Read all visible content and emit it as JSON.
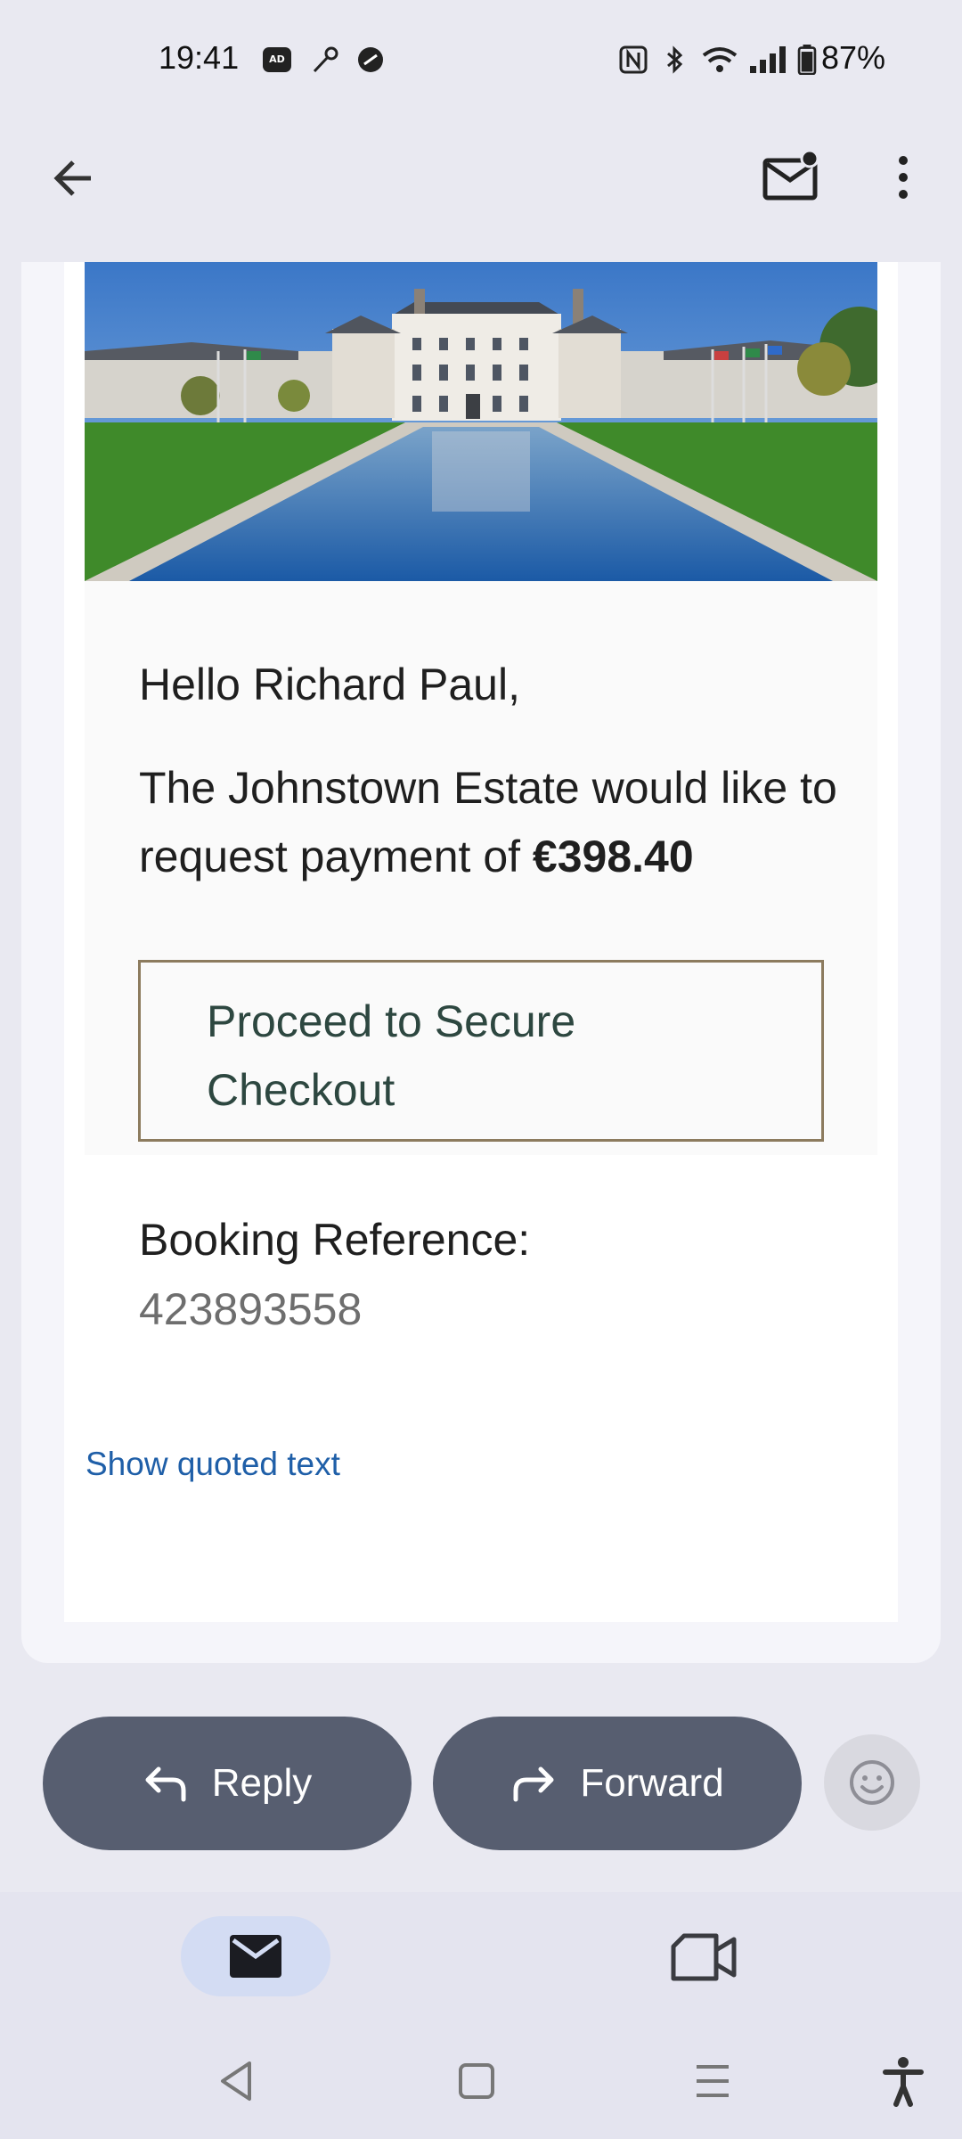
{
  "status_bar": {
    "time": "19:41",
    "battery": "87%",
    "left_icons": [
      "ad-blocker-icon",
      "key-icon",
      "vpn-icon"
    ],
    "right_icons": [
      "nfc-icon",
      "bluetooth-icon",
      "wifi-icon",
      "signal-icon",
      "battery-icon"
    ]
  },
  "app_bar": {
    "icons": [
      "back-arrow-icon",
      "mark-unread-icon",
      "more-vert-icon"
    ]
  },
  "email": {
    "hero_image": "johnstown-estate-hotel-photo",
    "greeting": "Hello Richard Paul,",
    "message_prefix": "The Johnstown Estate would like to request payment of ",
    "amount": "€398.40",
    "checkout_button": "Proceed to Secure Checkout",
    "booking_ref_label": "Booking Reference:",
    "booking_ref_value": "423893558",
    "show_quoted": "Show quoted text"
  },
  "actions": {
    "reply": "Reply",
    "forward": "Forward",
    "emoji_icon": "add-reaction-icon"
  },
  "bottom_nav": {
    "tabs": [
      "mail-icon",
      "meet-video-icon"
    ],
    "active": "mail"
  },
  "system_nav": [
    "back-triangle-icon",
    "home-square-icon",
    "recents-icon",
    "accessibility-icon"
  ],
  "colors": {
    "background": "#e9e9f1",
    "pill": "#575e70",
    "link": "#1f5fa8",
    "checkout_border": "#8c7b5e",
    "checkout_text": "#2d4740",
    "mail_tab_active": "#d3dcf3"
  }
}
